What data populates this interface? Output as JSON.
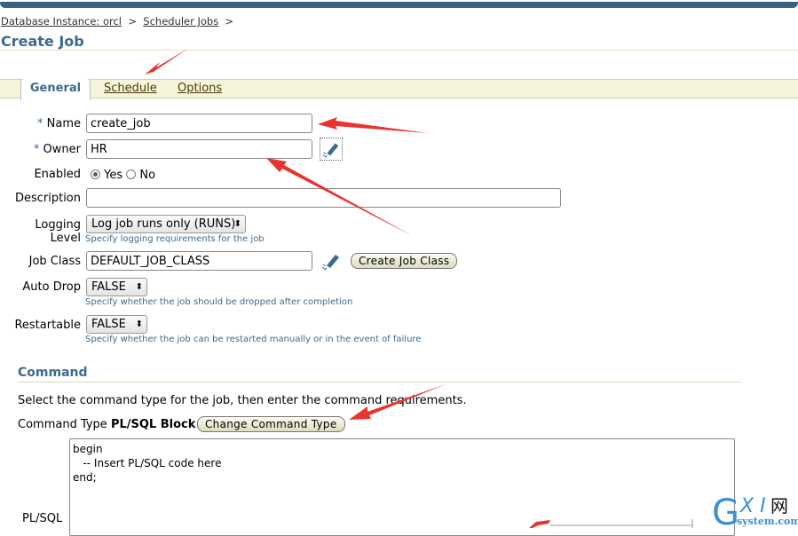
{
  "breadcrumb": {
    "items": [
      "Database Instance: orcl",
      "Scheduler Jobs"
    ],
    "separator": ">"
  },
  "page_title": "Create Job",
  "tabs": [
    {
      "label": "General",
      "active": true
    },
    {
      "label": "Schedule"
    },
    {
      "label": "Options"
    }
  ],
  "form": {
    "required_mark": "*",
    "name": {
      "label": "Name",
      "value": "create_job"
    },
    "owner": {
      "label": "Owner",
      "value": "HR"
    },
    "enabled": {
      "label": "Enabled",
      "options": [
        "Yes",
        "No"
      ],
      "selected": "Yes"
    },
    "description": {
      "label": "Description",
      "value": ""
    },
    "logging_level": {
      "label": "Logging Level",
      "value": "Log job runs only (RUNS)",
      "hint": "Specify logging requirements for the job"
    },
    "job_class": {
      "label": "Job Class",
      "value": "DEFAULT_JOB_CLASS",
      "button": "Create Job Class"
    },
    "auto_drop": {
      "label": "Auto Drop",
      "value": "FALSE",
      "hint": "Specify whether the job should be dropped after completion"
    },
    "restartable": {
      "label": "Restartable",
      "value": "FALSE",
      "hint": "Specify whether the job can be restarted manually or in the event of failure"
    }
  },
  "command": {
    "heading": "Command",
    "instructions": "Select the command type for the job, then enter the command requirements.",
    "type_label": "Command Type",
    "type_value": "PL/SQL Block",
    "change_button": "Change Command Type",
    "plsql_label": "PL/SQL",
    "plsql_code": "begin\n   -- Insert PL/SQL code here\nend;"
  },
  "watermark": {
    "text": "GXI网 system.com"
  },
  "colors": {
    "accent": "#3c6a91",
    "annotation_arrow": "#e8332e",
    "topbar": "#3a5f89"
  }
}
